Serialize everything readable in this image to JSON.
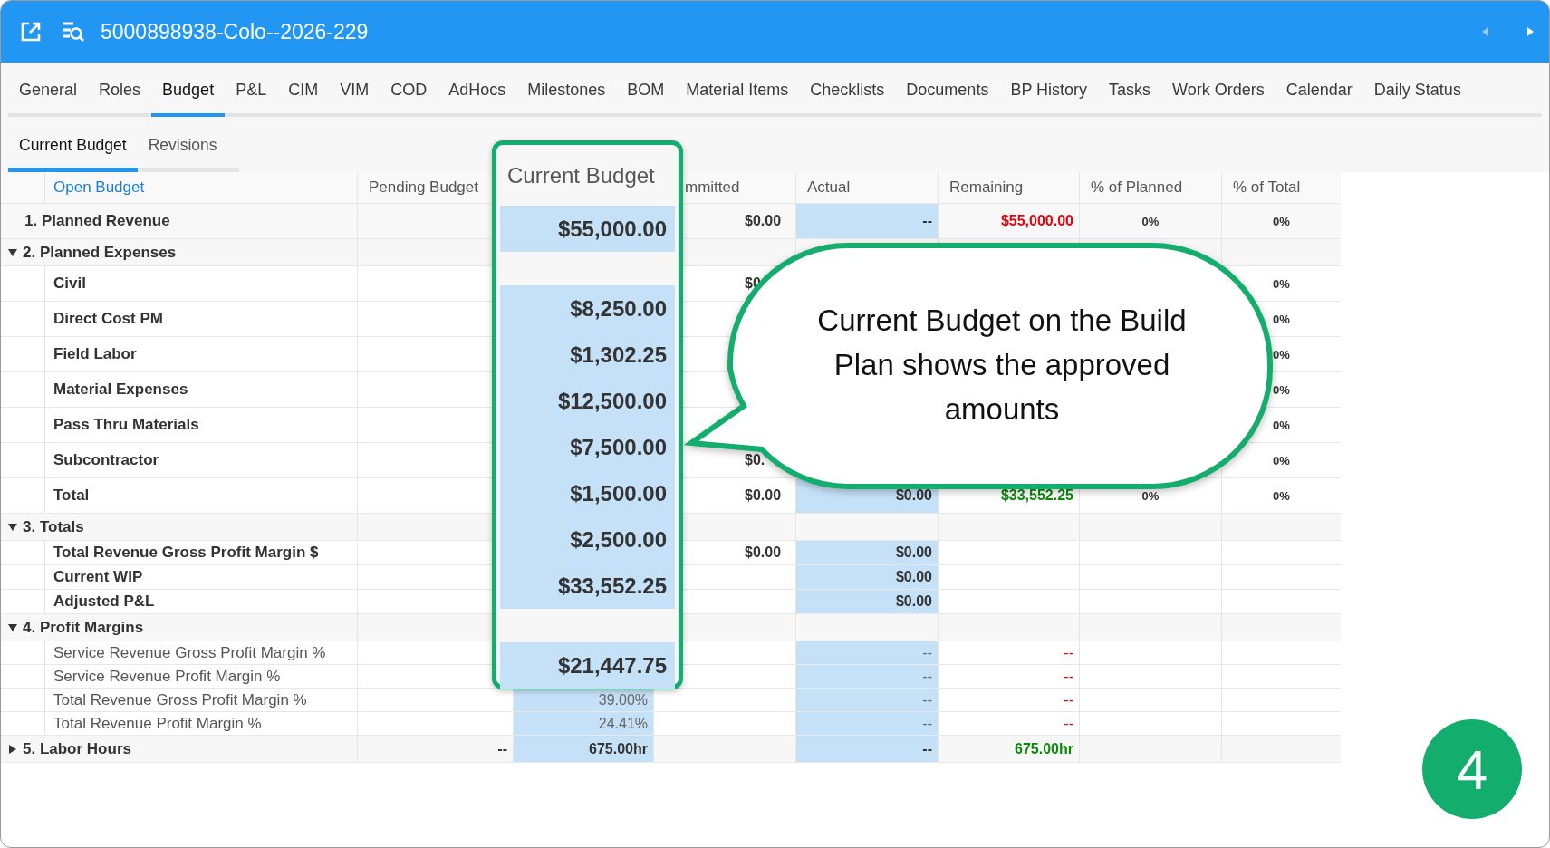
{
  "window": {
    "title": "5000898938-Colo--2026-229"
  },
  "tabs": [
    {
      "label": "General",
      "selected": false
    },
    {
      "label": "Roles",
      "selected": false
    },
    {
      "label": "Budget",
      "selected": true
    },
    {
      "label": "P&L",
      "selected": false
    },
    {
      "label": "CIM",
      "selected": false
    },
    {
      "label": "VIM",
      "selected": false
    },
    {
      "label": "COD",
      "selected": false
    },
    {
      "label": "AdHocs",
      "selected": false
    },
    {
      "label": "Milestones",
      "selected": false
    },
    {
      "label": "BOM",
      "selected": false
    },
    {
      "label": "Material Items",
      "selected": false
    },
    {
      "label": "Checklists",
      "selected": false
    },
    {
      "label": "Documents",
      "selected": false
    },
    {
      "label": "BP History",
      "selected": false
    },
    {
      "label": "Tasks",
      "selected": false
    },
    {
      "label": "Work Orders",
      "selected": false
    },
    {
      "label": "Calendar",
      "selected": false
    },
    {
      "label": "Daily Status",
      "selected": false
    }
  ],
  "subtabs": [
    {
      "label": "Current Budget",
      "selected": true
    },
    {
      "label": "Revisions",
      "selected": false
    }
  ],
  "table": {
    "header": {
      "name": "Open Budget",
      "pending": "Pending Budget",
      "committed": "mmitted",
      "actual": "Actual",
      "remaining": "Remaining",
      "pct_planned": "% of Planned",
      "pct_total": "% of Total"
    },
    "rows": [
      {
        "kind": "line",
        "label": "1. Planned Revenue",
        "committed": "$0.00",
        "actual": "--",
        "remaining": {
          "text": "$55,000.00",
          "color": "#e8000b"
        },
        "pct_planned": "0%",
        "pct_total": "0%"
      },
      {
        "kind": "section",
        "label": "2. Planned Expenses",
        "expanded": true,
        "children": [
          {
            "kind": "line",
            "label": "Civil",
            "committed": "$0",
            "pct_total": "0%"
          },
          {
            "kind": "line",
            "label": "Direct Cost PM",
            "pct_total": "0%"
          },
          {
            "kind": "line",
            "label": "Field Labor",
            "pct_total": "0%"
          },
          {
            "kind": "line",
            "label": "Material Expenses",
            "pct_total": "0%"
          },
          {
            "kind": "line",
            "label": "Pass Thru Materials",
            "pct_total": "0%"
          },
          {
            "kind": "line",
            "label": "Subcontractor",
            "committed": "$0.",
            "pct_total": "0%"
          },
          {
            "kind": "line",
            "label": "Total",
            "committed": "$0.00",
            "actual": "$0.00",
            "remaining": {
              "text": "$33,552.25",
              "color": "#0a8a0a"
            },
            "pct_planned": "0%",
            "pct_total": "0%"
          }
        ]
      },
      {
        "kind": "section",
        "label": "3. Totals",
        "expanded": true,
        "children": [
          {
            "kind": "total",
            "label": "Total Revenue Gross Profit Margin $",
            "committed": "$0.00",
            "actual": "$0.00"
          },
          {
            "kind": "total",
            "label": "Current WIP",
            "actual": "$0.00"
          },
          {
            "kind": "total",
            "label": "Adjusted P&L",
            "actual": "$0.00"
          }
        ]
      },
      {
        "kind": "section",
        "label": "4. Profit Margins",
        "expanded": true,
        "children": [
          {
            "kind": "metric",
            "label": "Service Revenue Gross Profit Margin %",
            "actual": "--",
            "remaining": {
              "text": "--",
              "color": "#e8000b"
            }
          },
          {
            "kind": "metric",
            "label": "Service Revenue Profit Margin %",
            "actual": "--",
            "remaining": {
              "text": "--",
              "color": "#e8000b"
            }
          },
          {
            "kind": "metric",
            "label": "Total Revenue Gross Profit Margin %",
            "current": "39.00%",
            "actual": "--",
            "remaining": {
              "text": "--",
              "color": "#e8000b"
            }
          },
          {
            "kind": "metric",
            "label": "Total Revenue Profit Margin %",
            "current": "24.41%",
            "actual": "--",
            "remaining": {
              "text": "--",
              "color": "#e8000b"
            }
          }
        ]
      },
      {
        "kind": "section",
        "label": "5. Labor Hours",
        "expanded": false,
        "pending": "--",
        "current": "675.00hr",
        "actual": "--",
        "remaining": {
          "text": "675.00hr",
          "color": "#0a8a0a"
        }
      }
    ]
  },
  "callout_column": {
    "header": "Current Budget",
    "blocks": [
      [
        "$55,000.00"
      ],
      [
        "$8,250.00",
        "$1,302.25",
        "$12,500.00",
        "$7,500.00",
        "$1,500.00",
        "$2,500.00",
        "$33,552.25"
      ],
      [
        "$21,447.75"
      ]
    ]
  },
  "callout": {
    "text": "Current Budget on the Build Plan shows the approved amounts"
  },
  "step_badge": {
    "label": "4"
  }
}
